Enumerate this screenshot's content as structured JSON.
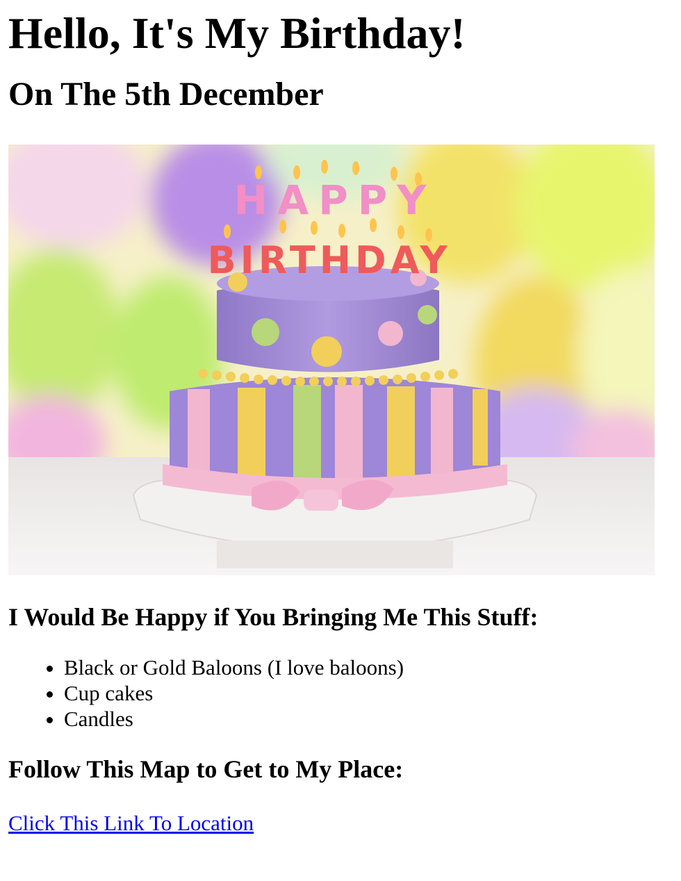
{
  "page": {
    "title": "Hello, It's My Birthday!",
    "subtitle": "On The 5th December"
  },
  "hero_image": {
    "cake_letters_top": "HAPPY",
    "cake_letters_bottom": "BIRTHDAY",
    "colors": {
      "purple": "#a78bd6",
      "pink": "#f2b6cf",
      "yellow": "#f1cf5a",
      "green": "#b7d77a",
      "board": "#f3f1ef"
    }
  },
  "wishlist": {
    "heading": "I Would Be Happy if You Bringing Me This Stuff:",
    "items": [
      "Black or Gold Baloons (I love baloons)",
      "Cup cakes",
      "Candles"
    ]
  },
  "location": {
    "heading": "Follow This Map to Get to My Place:",
    "link_text": "Click This Link To Location"
  }
}
